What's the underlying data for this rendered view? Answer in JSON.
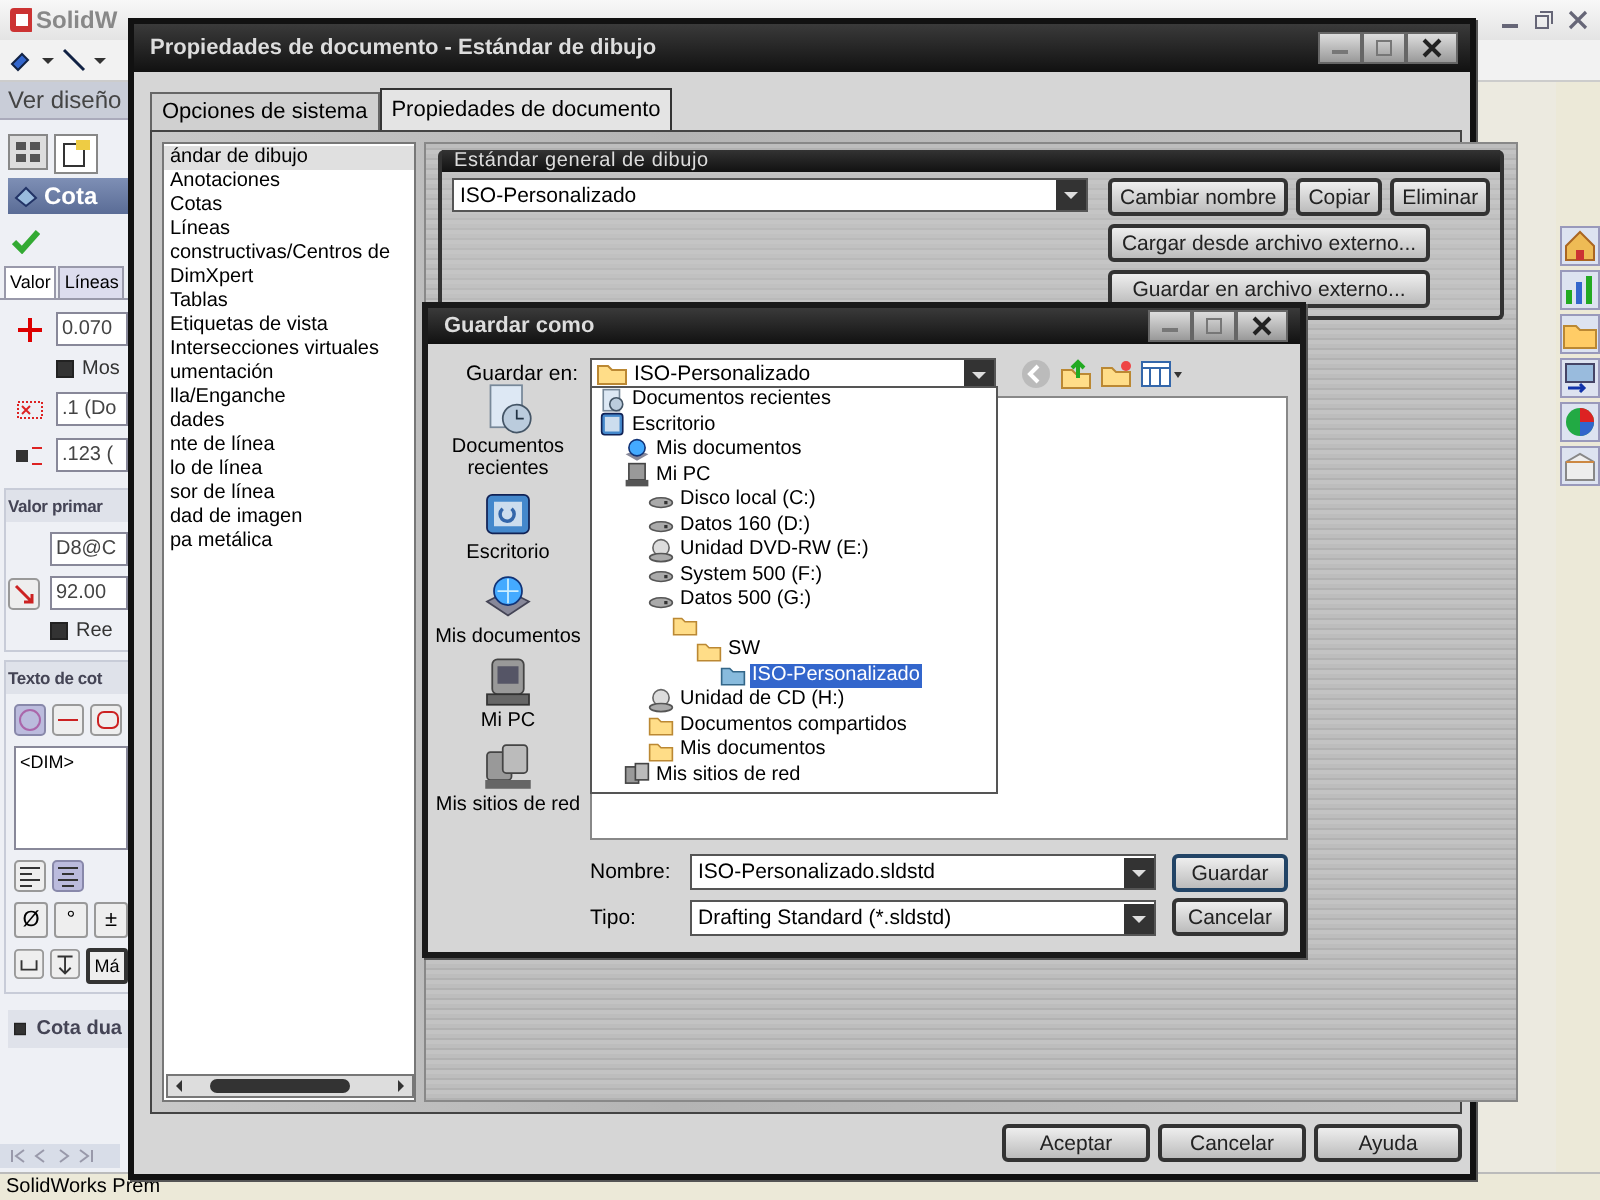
{
  "app": {
    "logo": "SolidW",
    "view_tab": "Ver diseño",
    "status": "SolidWorks Prem"
  },
  "property_manager": {
    "title": "Cota",
    "tabs": [
      {
        "label": "Valor",
        "selected": true
      },
      {
        "label": "Líneas",
        "selected": false
      }
    ],
    "tolerance_value": "0.070",
    "show_option": "Mos",
    "primary_precision": ".1 (Do",
    "tolerance_precision": ".123 (",
    "primary_section": "Valor primar",
    "dimension_name": "D8@C",
    "dimension_value": "92.00",
    "override_option": "Ree",
    "text_section": "Texto de cot",
    "dimension_text": "<DIM>",
    "symbols": [
      "Ø",
      "°",
      "±"
    ],
    "more_button": "Má",
    "dual_section": "Cota dua"
  },
  "doc_dialog": {
    "title": "Propiedades de documento - Estándar de dibujo",
    "tabs": [
      {
        "label": "Opciones de sistema",
        "selected": false
      },
      {
        "label": "Propiedades de documento",
        "selected": true
      }
    ],
    "tree": [
      {
        "label": "ándar de dibujo",
        "selected": true
      },
      {
        "label": "Anotaciones",
        "selected": false
      },
      {
        "label": "Cotas",
        "selected": false
      },
      {
        "label": "Líneas constructivas/Centros de",
        "selected": false
      },
      {
        "label": "DimXpert",
        "selected": false
      },
      {
        "label": "Tablas",
        "selected": false
      },
      {
        "label": "Etiquetas de vista",
        "selected": false
      },
      {
        "label": "Intersecciones virtuales",
        "selected": false
      },
      {
        "label": "umentación",
        "selected": false
      },
      {
        "label": "lla/Enganche",
        "selected": false
      },
      {
        "label": "dades",
        "selected": false
      },
      {
        "label": "nte de línea",
        "selected": false
      },
      {
        "label": "lo de línea",
        "selected": false
      },
      {
        "label": "sor de línea",
        "selected": false
      },
      {
        "label": "dad de imagen",
        "selected": false
      },
      {
        "label": "pa metálica",
        "selected": false
      }
    ],
    "group_title": "Estándar general de dibujo",
    "standard_value": "ISO-Personalizado",
    "buttons": [
      "Cambiar nombre",
      "Copiar",
      "Eliminar"
    ],
    "file_buttons": [
      "Cargar desde archivo externo...",
      "Guardar en archivo externo..."
    ],
    "footer_buttons": [
      "Aceptar",
      "Cancelar",
      "Ayuda"
    ]
  },
  "save_dialog": {
    "title": "Guardar como",
    "save_in_label": "Guardar en:",
    "save_in_value": "ISO-Personalizado",
    "places": [
      {
        "label": "Documentos recientes",
        "kind": "recent"
      },
      {
        "label": "Escritorio",
        "kind": "desktop"
      },
      {
        "label": "Mis documentos",
        "kind": "documents"
      },
      {
        "label": "Mi PC",
        "kind": "computer"
      },
      {
        "label": "Mis sitios de red",
        "kind": "network"
      }
    ],
    "locations": [
      {
        "label": "Documentos recientes",
        "kind": "recent",
        "selected": false
      },
      {
        "label": "Escritorio",
        "kind": "desktop",
        "selected": false,
        "children": [
          {
            "label": "Mis documentos",
            "kind": "documents",
            "selected": false
          },
          {
            "label": "Mi PC",
            "kind": "computer",
            "selected": false,
            "children": [
              {
                "label": "Disco local (C:)",
                "kind": "drive",
                "selected": false
              },
              {
                "label": "Datos 160 (D:)",
                "kind": "drive",
                "selected": false
              },
              {
                "label": "Unidad DVD-RW (E:)",
                "kind": "optical",
                "selected": false
              },
              {
                "label": "System 500 (F:)",
                "kind": "drive",
                "selected": false
              },
              {
                "label": "Datos 500 (G:)",
                "kind": "drive",
                "selected": false,
                "children": [
                  {
                    "kind": "folder",
                    "selected": false,
                    "children": [
                      {
                        "label": "SW",
                        "kind": "folder",
                        "selected": false,
                        "children": [
                          {
                            "label": "ISO-Personalizado",
                            "kind": "folder",
                            "selected": true
                          }
                        ]
                      }
                    ]
                  }
                ]
              },
              {
                "label": "Unidad de CD (H:)",
                "kind": "optical",
                "selected": false
              },
              {
                "label": "Documentos compartidos",
                "kind": "folder",
                "selected": false
              },
              {
                "label": "Mis documentos",
                "kind": "folder",
                "selected": false
              }
            ]
          },
          {
            "label": "Mis sitios de red",
            "kind": "network",
            "selected": false
          }
        ]
      }
    ],
    "name_label": "Nombre:",
    "name_value": "ISO-Personalizado.sldstd",
    "type_label": "Tipo:",
    "type_value": "Drafting Standard (*.sldstd)",
    "buttons": [
      "Guardar",
      "Cancelar"
    ]
  }
}
